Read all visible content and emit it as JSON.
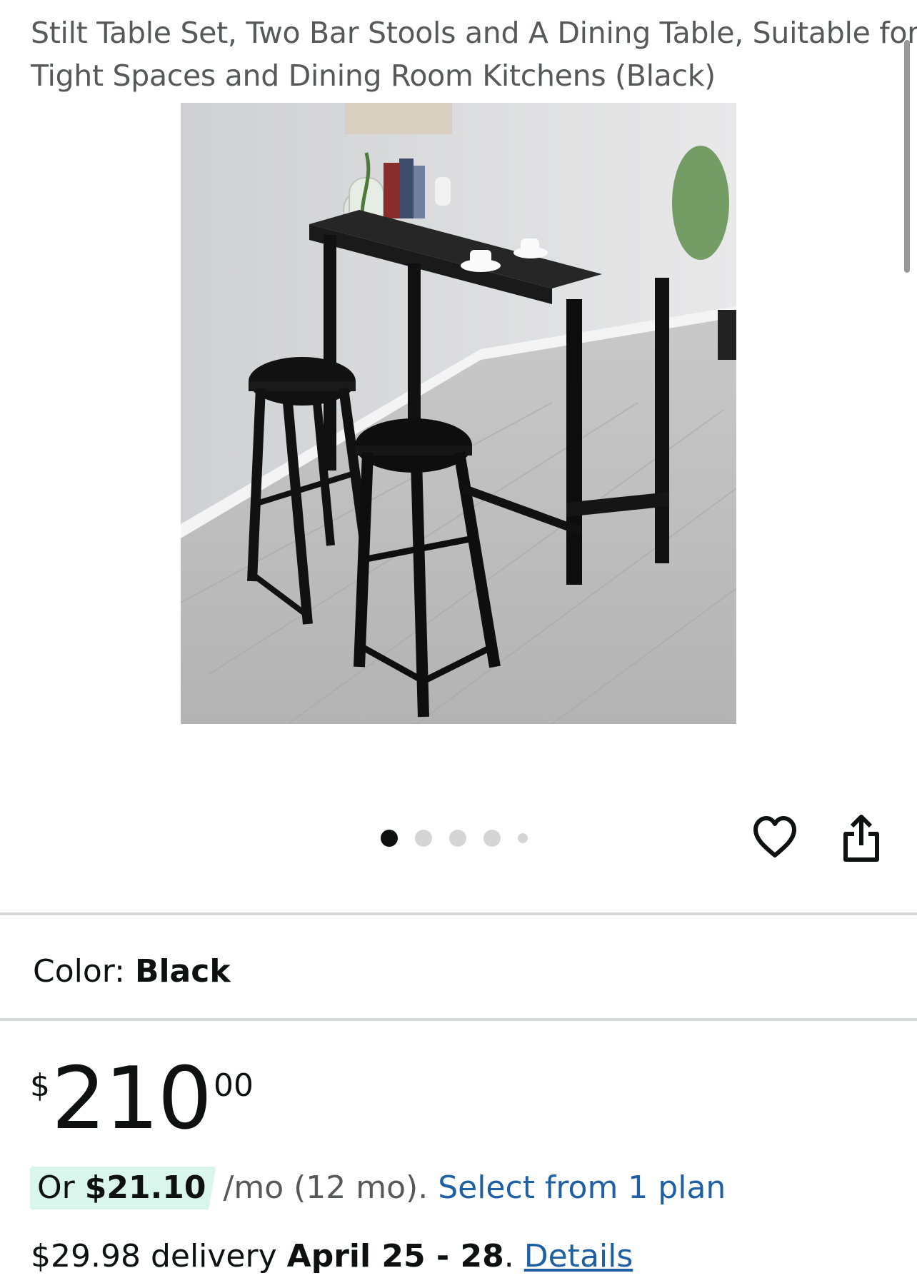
{
  "product": {
    "title_line1": "Stilt Table Set, Two Bar Stools and A Dining Table, Suitable for",
    "title_line2": "Tight Spaces and Dining Room Kitchens (Black)"
  },
  "gallery": {
    "image_count": 5,
    "active_index": 0,
    "favorite_icon": "heart-icon",
    "share_icon": "share-icon"
  },
  "color": {
    "label": "Color:",
    "value": "Black"
  },
  "price": {
    "symbol": "$",
    "whole": "210",
    "fraction": "00"
  },
  "financing": {
    "prefix": "Or",
    "monthly": "$21.10",
    "term": "/mo (12 mo).",
    "link": "Select from 1 plan"
  },
  "delivery": {
    "fee": "$29.98 delivery",
    "dates": "April 25 - 28",
    "period": ".",
    "details_link": "Details"
  },
  "colors": {
    "link": "#1f5fa3",
    "finance_highlight": "#d9f5ec",
    "divider": "#d5d9d9"
  }
}
